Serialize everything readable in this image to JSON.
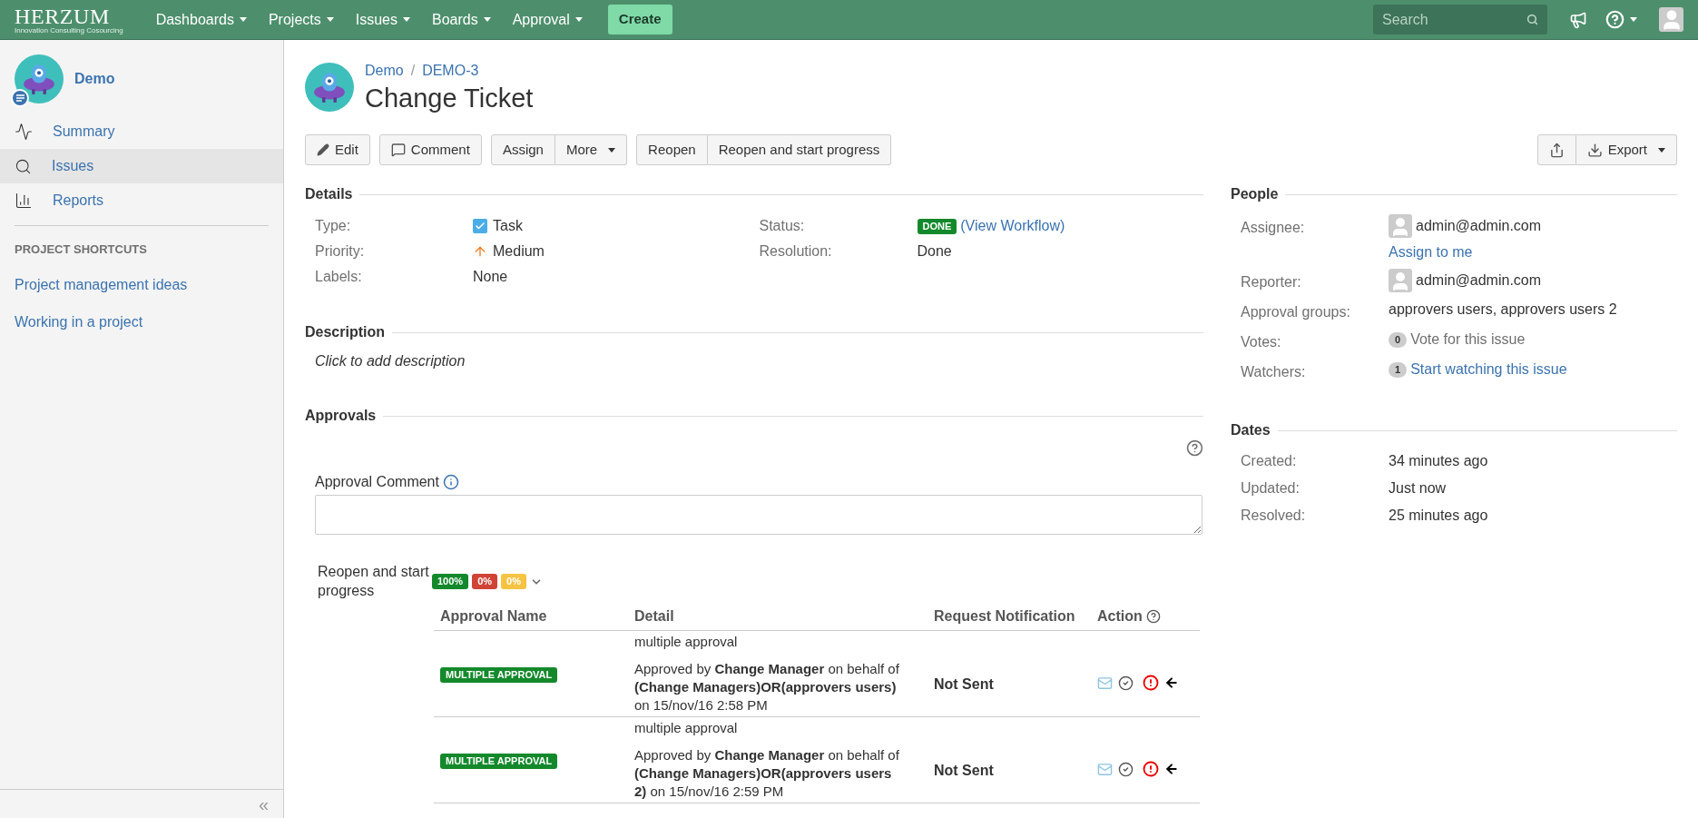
{
  "topbar": {
    "logo": "HERZUM",
    "tagline": "Innovation Consulting Cosourcing",
    "menus": [
      "Dashboards",
      "Projects",
      "Issues",
      "Boards",
      "Approval"
    ],
    "create": "Create",
    "search": {
      "placeholder": "Search"
    }
  },
  "sidebar": {
    "project": "Demo",
    "items": [
      {
        "label": "Summary",
        "kind": "summary",
        "selected": false
      },
      {
        "label": "Issues",
        "kind": "issues",
        "selected": true
      },
      {
        "label": "Reports",
        "kind": "reports",
        "selected": false
      }
    ],
    "shortcuts_heading": "PROJECT SHORTCUTS",
    "shortcuts": [
      "Project management ideas",
      "Working in a project"
    ],
    "collapse": "«"
  },
  "issue": {
    "breadcrumb": [
      "Demo",
      "DEMO-3"
    ],
    "breadcrumb_separator": "/",
    "title": "Change Ticket",
    "toolbar": [
      [
        {
          "label": "Edit",
          "kind": "edit"
        }
      ],
      [
        {
          "label": "Comment",
          "kind": "comment"
        }
      ],
      [
        {
          "label": "Assign",
          "kind": "plain"
        },
        {
          "label": "More",
          "kind": "dropdown"
        }
      ],
      [
        {
          "label": "Reopen",
          "kind": "plain"
        },
        {
          "label": "Reopen and start progress",
          "kind": "plain"
        }
      ]
    ],
    "toolbar_right": [
      {
        "kind": "share"
      },
      {
        "label": "Export",
        "kind": "export"
      }
    ],
    "details": {
      "heading": "Details",
      "left": [
        {
          "label": "Type:",
          "value": "Task",
          "kind": "type"
        },
        {
          "label": "Priority:",
          "value": "Medium",
          "kind": "priority"
        },
        {
          "label": "Labels:",
          "value": "None",
          "kind": "plain"
        }
      ],
      "right": [
        {
          "label": "Status:",
          "value": "DONE",
          "link": "(View Workflow)",
          "kind": "status"
        },
        {
          "label": "Resolution:",
          "value": "Done",
          "kind": "plain"
        }
      ]
    },
    "description": {
      "heading": "Description",
      "placeholder": "Click to add description"
    },
    "approvals": {
      "heading": "Approvals",
      "comment_label": "Approval Comment",
      "transition": "Reopen and start progress",
      "badges": [
        {
          "text": "100%",
          "color": "#14892c"
        },
        {
          "text": "0%",
          "color": "#d04437"
        },
        {
          "text": "0%",
          "color": "#f6c342"
        }
      ],
      "columns": [
        "Approval Name",
        "Detail",
        "Request Notification",
        "Action"
      ],
      "rows": [
        {
          "name": "MULTIPLE APPROVAL",
          "title": "multiple approval",
          "detail": "Approved by **Change Manager** on behalf of **(Change Managers)OR(approvers users)** on 15/nov/16 2:58 PM",
          "notification": "Not Sent"
        },
        {
          "name": "MULTIPLE APPROVAL",
          "title": "multiple approval",
          "detail": "Approved by **Change Manager** on behalf of **(Change Managers)OR(approvers users 2)** on 15/nov/16 2:59 PM",
          "notification": "Not Sent"
        }
      ]
    }
  },
  "people": {
    "heading": "People",
    "rows": [
      {
        "label": "Assignee:",
        "value": "admin@admin.com",
        "link": "Assign to me",
        "kind": "user"
      },
      {
        "label": "Reporter:",
        "value": "admin@admin.com",
        "kind": "user"
      },
      {
        "label": "Approval groups:",
        "value": "approvers users, approvers users 2",
        "kind": "plain"
      },
      {
        "label": "Votes:",
        "count": "0",
        "value": "Vote for this issue",
        "kind": "votes"
      },
      {
        "label": "Watchers:",
        "count": "1",
        "value": "Start watching this issue",
        "kind": "watchers"
      }
    ]
  },
  "dates": {
    "heading": "Dates",
    "rows": [
      {
        "label": "Created:",
        "value": "34 minutes ago"
      },
      {
        "label": "Updated:",
        "value": "Just now"
      },
      {
        "label": "Resolved:",
        "value": "25 minutes ago"
      }
    ]
  }
}
